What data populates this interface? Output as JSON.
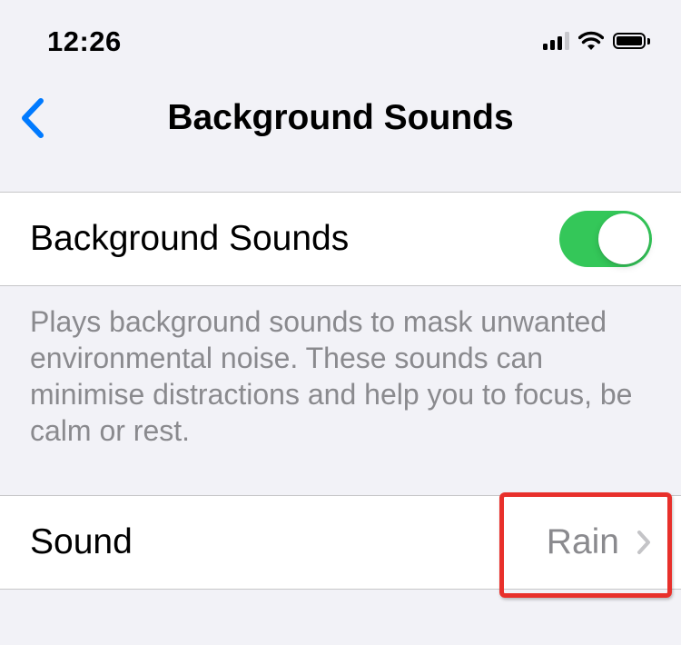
{
  "status_bar": {
    "time": "12:26",
    "icons": [
      "signal-icon",
      "wifi-icon",
      "battery-icon"
    ]
  },
  "nav": {
    "back_icon": "chevron-left-icon",
    "title": "Background Sounds"
  },
  "toggle_row": {
    "label": "Background Sounds",
    "enabled": true
  },
  "footer": {
    "text": "Plays background sounds to mask unwanted environmental noise. These sounds can minimise distractions and help you to focus, be calm or rest."
  },
  "sound_row": {
    "label": "Sound",
    "value": "Rain",
    "chevron_icon": "chevron-right-icon"
  },
  "colors": {
    "accent_blue": "#007aff",
    "toggle_on": "#34c759",
    "background": "#f2f2f7",
    "secondary_text": "#8a8a8e",
    "highlight": "#e8302b"
  }
}
